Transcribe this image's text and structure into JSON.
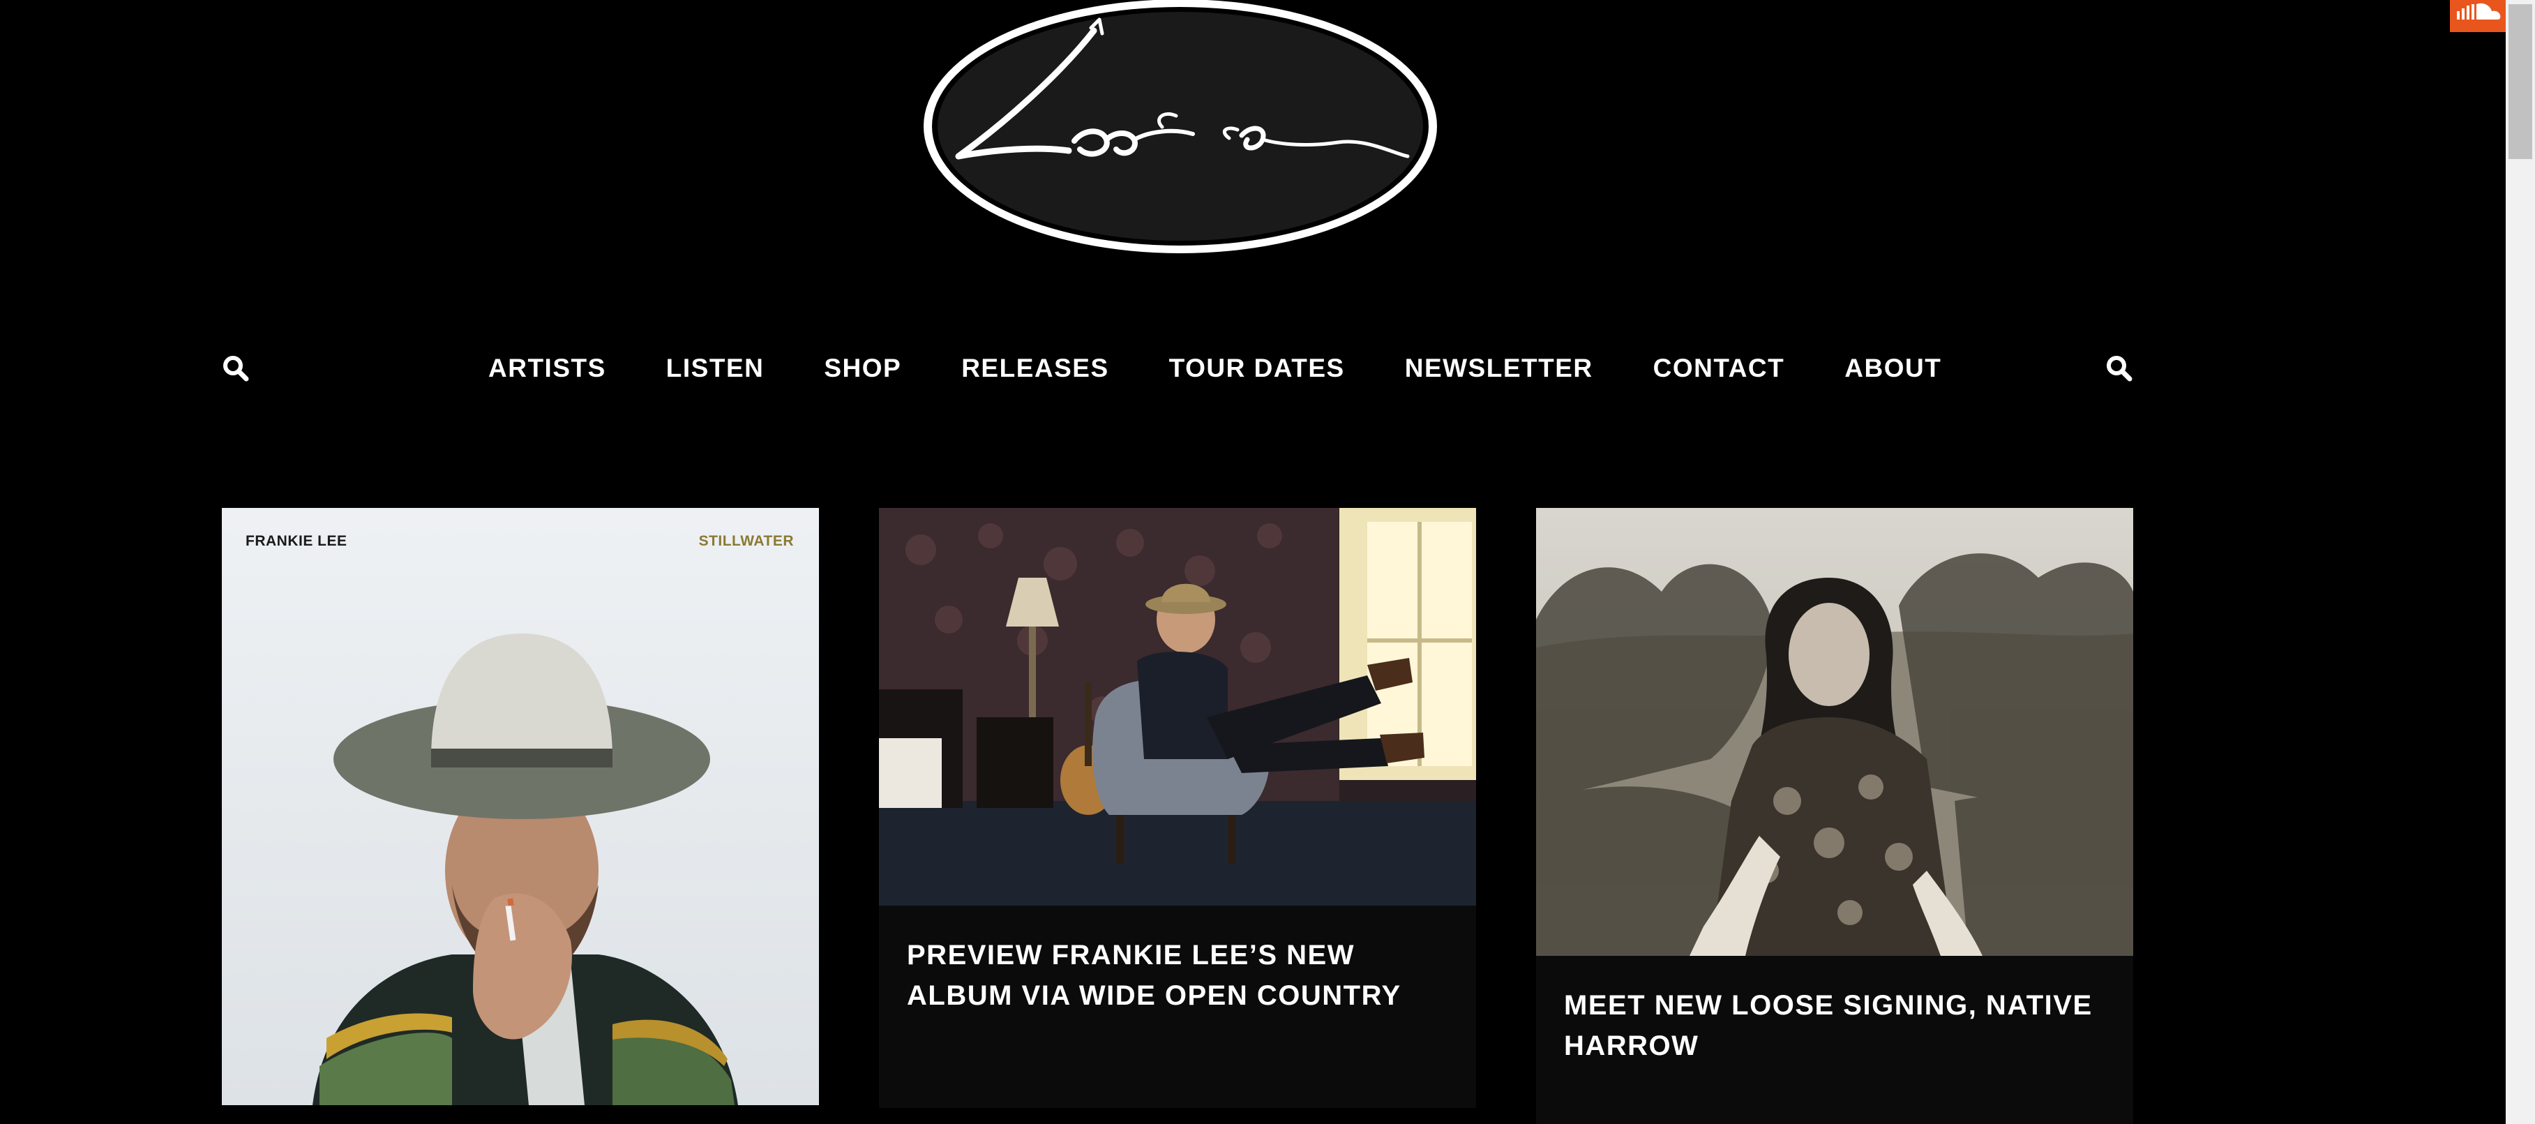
{
  "site": {
    "logo_text": "Loose"
  },
  "nav": {
    "items": [
      {
        "label": "ARTISTS"
      },
      {
        "label": "LISTEN"
      },
      {
        "label": "SHOP"
      },
      {
        "label": "RELEASES"
      },
      {
        "label": "TOUR DATES"
      },
      {
        "label": "NEWSLETTER"
      },
      {
        "label": "CONTACT"
      },
      {
        "label": "ABOUT"
      }
    ],
    "search_icon": "search-icon"
  },
  "posts": [
    {
      "cover_artist": "FRANKIE LEE",
      "cover_album": "STILLWATER",
      "title": ""
    },
    {
      "title": "PREVIEW FRANKIE LEE’S NEW ALBUM VIA WIDE OPEN COUNTRY"
    },
    {
      "title": "MEET NEW LOOSE SIGNING, NATIVE HARROW"
    }
  ],
  "widgets": {
    "soundcloud_icon": "soundcloud-icon",
    "soundcloud_color": "#e8561d"
  },
  "colors": {
    "background": "#000000",
    "card_background": "#0b0b0b",
    "album_accent": "#8a7a32"
  }
}
